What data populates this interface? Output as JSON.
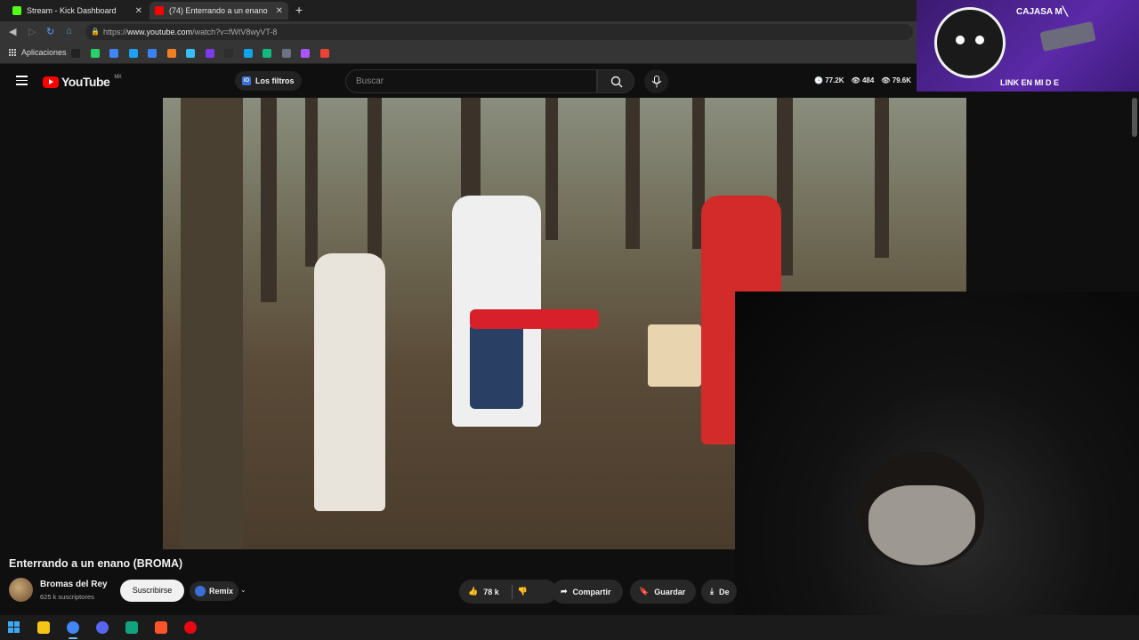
{
  "browser": {
    "tabs": [
      {
        "label": "Stream - Kick Dashboard",
        "color": "#53fc18"
      },
      {
        "label": "(74) Enterrando a un enano",
        "color": "#ff0000"
      }
    ],
    "url_prefix": "https://",
    "url_domain": "www.youtube.com",
    "url_path": "/watch?v=fWtV8wyVT-8",
    "bookmarks_label": "Aplicaciones",
    "bookmark_colors": [
      "#222222",
      "#25d366",
      "#4285f4",
      "#1da1f2",
      "#3b82f6",
      "#f48024",
      "#38bdf8",
      "#7c3aed",
      "#2e2e2e",
      "#0ea5e9",
      "#10b981",
      "#6b7280",
      "#a855f7",
      "#ea4335"
    ]
  },
  "youtube": {
    "logo_text": "YouTube",
    "region": "MX",
    "filters_label": "Los filtros",
    "search_placeholder": "Buscar",
    "stats": [
      "77.2K",
      "484",
      "79.6K"
    ]
  },
  "overlay": {
    "top_text": "CAJASA M╲",
    "bottom_text": "LINK EN MI D  E"
  },
  "video": {
    "title": "Enterrando a un enano (BROMA)",
    "channel": "Bromas del Rey",
    "subscribers": "625 k suscriptores",
    "subscribe_label": "Suscribirse",
    "remix_label": "Remix",
    "likes": "78 k",
    "share_label": "Compartir",
    "save_label": "Guardar",
    "download_label": "De"
  },
  "colors": {
    "accent_red": "#ff0000",
    "bg": "#0f0f0f",
    "overlay_purple": "#5b2aa8"
  }
}
